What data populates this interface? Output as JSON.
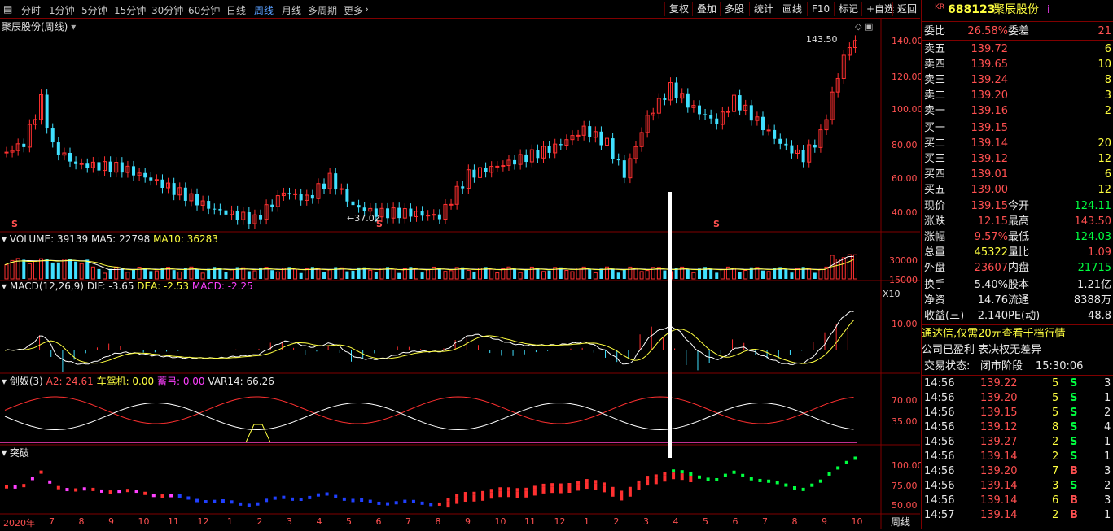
{
  "toolbar": {
    "periods": [
      "分时",
      "1分钟",
      "5分钟",
      "15分钟",
      "30分钟",
      "60分钟",
      "日线",
      "周线",
      "月线",
      "多周期",
      "更多"
    ],
    "active": "周线",
    "right_buttons": [
      "复权",
      "叠加",
      "多股",
      "统计",
      "画线",
      "F10",
      "标记",
      "+自选",
      "返回"
    ]
  },
  "chart": {
    "title": "聚辰股份(周线)",
    "high_label": "143.50",
    "low_label": "37.02",
    "price_axis": [
      "140.00",
      "120.00",
      "100.00",
      "80.00",
      "60.00",
      "40.00"
    ],
    "volume_header": {
      "name": "VOLUME:",
      "value": "39139",
      "ma5_name": "MA5:",
      "ma5": "22798",
      "ma10_name": "MA10:",
      "ma10": "36283"
    },
    "volume_axis": [
      "30000",
      "15000"
    ],
    "volume_unit": "X10",
    "macd_header": {
      "name": "MACD(12,26,9)",
      "dif": "DIF: -3.65",
      "dea": "DEA: -2.53",
      "macd": "MACD: -2.25"
    },
    "macd_axis": [
      "10.00"
    ],
    "jn_header": {
      "name": "剑奴(3)",
      "a2": "A2: 24.61",
      "cjj": "车驾机: 0.00",
      "qg": "蓄弓: 0.00",
      "var": "VAR14: 66.26"
    },
    "jn_axis": [
      "70.00",
      "35.00"
    ],
    "tp_header": {
      "name": "突破"
    },
    "tp_axis": [
      "100.00",
      "75.00",
      "50.00"
    ],
    "dates": [
      "2020年",
      "7",
      "8",
      "9",
      "10",
      "11",
      "12",
      "1",
      "2",
      "3",
      "4",
      "5",
      "6",
      "7",
      "8",
      "9",
      "10",
      "11",
      "12",
      "1",
      "2",
      "3",
      "4",
      "5",
      "6",
      "7",
      "8",
      "9",
      "10"
    ],
    "period_label": "周线",
    "s_marks": [
      "S",
      "S",
      "S"
    ]
  },
  "quote": {
    "badge": "KR",
    "code": "688123",
    "name": "聚辰股份",
    "suffix": "i",
    "weibi_label": "委比",
    "weibi": "26.58%",
    "weicha_label": "委差",
    "weicha": "21",
    "asks": [
      {
        "label": "卖五",
        "price": "139.72",
        "vol": "6"
      },
      {
        "label": "卖四",
        "price": "139.65",
        "vol": "10"
      },
      {
        "label": "卖三",
        "price": "139.24",
        "vol": "8"
      },
      {
        "label": "卖二",
        "price": "139.20",
        "vol": "3"
      },
      {
        "label": "卖一",
        "price": "139.16",
        "vol": "2"
      }
    ],
    "bids": [
      {
        "label": "买一",
        "price": "139.15",
        "vol": ""
      },
      {
        "label": "买二",
        "price": "139.14",
        "vol": "20"
      },
      {
        "label": "买三",
        "price": "139.12",
        "vol": "12"
      },
      {
        "label": "买四",
        "price": "139.01",
        "vol": "6"
      },
      {
        "label": "买五",
        "price": "139.00",
        "vol": "12"
      }
    ],
    "stats": [
      {
        "l1": "现价",
        "v1": "139.15",
        "l2": "今开",
        "v2": "124.11"
      },
      {
        "l1": "涨跌",
        "v1": "12.15",
        "l2": "最高",
        "v2": "143.50"
      },
      {
        "l1": "涨幅",
        "v1": "9.57%",
        "l2": "最低",
        "v2": "124.03"
      },
      {
        "l1": "总量",
        "v1": "45322",
        "l2": "量比",
        "v2": "1.09"
      },
      {
        "l1": "外盘",
        "v1": "23607",
        "l2": "内盘",
        "v2": "21715"
      }
    ],
    "stats2": [
      {
        "l1": "换手",
        "v1": "5.40%",
        "l2": "股本",
        "v2": "1.21亿"
      },
      {
        "l1": "净资",
        "v1": "14.76",
        "l2": "流通",
        "v2": "8388万"
      },
      {
        "l1": "收益(三)",
        "v1": "2.140",
        "l2": "PE(动)",
        "v2": "48.8"
      }
    ],
    "ad_line": "通达信,仅需20元查看千档行情",
    "info_line": "公司已盈利 表决权无差异",
    "status_label": "交易状态:",
    "status_value": "闭市阶段",
    "status_time": "15:30:06"
  },
  "ticks": [
    {
      "t": "14:56",
      "p": "139.22",
      "v": "5",
      "d": "S",
      "n": "3"
    },
    {
      "t": "14:56",
      "p": "139.20",
      "v": "5",
      "d": "S",
      "n": "1"
    },
    {
      "t": "14:56",
      "p": "139.15",
      "v": "5",
      "d": "S",
      "n": "2"
    },
    {
      "t": "14:56",
      "p": "139.12",
      "v": "8",
      "d": "S",
      "n": "4"
    },
    {
      "t": "14:56",
      "p": "139.27",
      "v": "2",
      "d": "S",
      "n": "1"
    },
    {
      "t": "14:56",
      "p": "139.14",
      "v": "2",
      "d": "S",
      "n": "1"
    },
    {
      "t": "14:56",
      "p": "139.20",
      "v": "7",
      "d": "B",
      "n": "3"
    },
    {
      "t": "14:56",
      "p": "139.14",
      "v": "3",
      "d": "S",
      "n": "2"
    },
    {
      "t": "14:56",
      "p": "139.14",
      "v": "6",
      "d": "B",
      "n": "3"
    },
    {
      "t": "14:57",
      "p": "139.14",
      "v": "2",
      "d": "B",
      "n": "1"
    }
  ],
  "colors": {
    "up": "#ff3030",
    "down": "#40e0ff",
    "frame": "#800000",
    "yellow": "#ffff00",
    "magenta": "#ff40ff"
  }
}
